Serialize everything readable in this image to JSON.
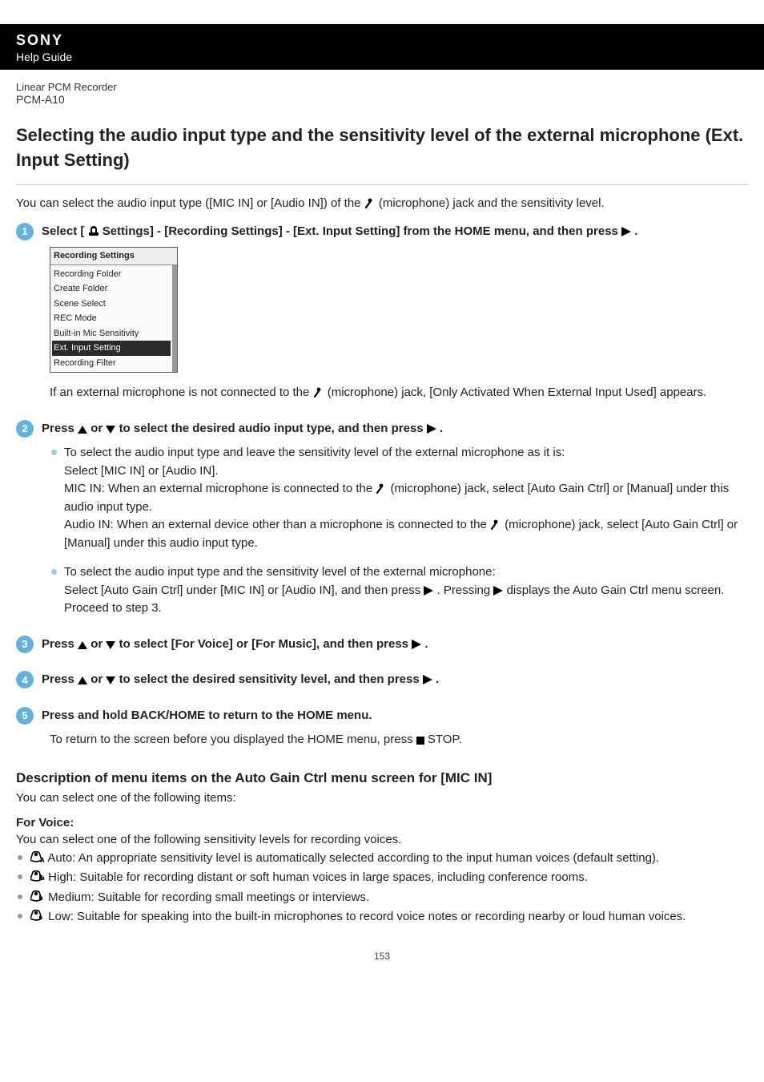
{
  "header": {
    "brand": "SONY",
    "help_guide": "Help Guide",
    "product": "Linear PCM Recorder",
    "model": "PCM-A10"
  },
  "title": "Selecting the audio input type and the sensitivity level of the external microphone (Ext. Input Setting)",
  "intro_parts": {
    "p1": "You can select the audio input type ([MIC IN] or [Audio IN]) of the ",
    "p2": " (microphone) jack and the sensitivity level."
  },
  "step1": {
    "num": "1",
    "inst_parts": {
      "a": "Select [ ",
      "b": " Settings] - [Recording Settings] - [Ext. Input Setting] from the HOME menu, and then press ",
      "c": " ."
    },
    "screenshot": {
      "title": "Recording Settings",
      "items": [
        "Recording Folder",
        "Create Folder",
        "Scene Select",
        "REC Mode",
        "Built-in Mic Sensitivity",
        "Ext. Input Setting",
        "Recording Filter"
      ],
      "selected_index": 5
    },
    "note_parts": {
      "a": "If an external microphone is not connected to the ",
      "b": " (microphone) jack, [Only Activated When External Input Used] appears."
    }
  },
  "step2": {
    "num": "2",
    "inst_parts": {
      "a": "Press ",
      "b": " or ",
      "c": " to select the desired audio input type, and then press ",
      "d": " ."
    },
    "bullet1": {
      "l1": "To select the audio input type and leave the sensitivity level of the external microphone as it is:",
      "l2": "Select [MIC IN] or [Audio IN].",
      "l3a": "MIC IN: When an external microphone is connected to the ",
      "l3b": " (microphone) jack, select [Auto Gain Ctrl] or [Manual] under this audio input type.",
      "l4a": "Audio IN: When an external device other than a microphone is connected to the ",
      "l4b": " (microphone) jack, select [Auto Gain Ctrl] or [Manual] under this audio input type."
    },
    "bullet2": {
      "l1": "To select the audio input type and the sensitivity level of the external microphone:",
      "l2a": "Select [Auto Gain Ctrl] under [MIC IN] or [Audio IN], and then press ",
      "l2b": " . Pressing ",
      "l2c": " displays the Auto Gain Ctrl menu screen. Proceed to step 3."
    }
  },
  "step3": {
    "num": "3",
    "inst_parts": {
      "a": "Press ",
      "b": " or ",
      "c": " to select [For Voice] or [For Music], and then press ",
      "d": " ."
    }
  },
  "step4": {
    "num": "4",
    "inst_parts": {
      "a": "Press ",
      "b": " or ",
      "c": " to select the desired sensitivity level, and then press ",
      "d": " ."
    }
  },
  "step5": {
    "num": "5",
    "inst": "Press and hold BACK/HOME to return to the HOME menu.",
    "body_parts": {
      "a": "To return to the screen before you displayed the HOME menu, press ",
      "b": " STOP."
    }
  },
  "desc": {
    "heading": "Description of menu items on the Auto Gain Ctrl menu screen for [MIC IN]",
    "sub": "You can select one of the following items:",
    "for_voice_heading": "For Voice:",
    "for_voice_sub": "You can select one of the following sensitivity levels for recording voices.",
    "items": {
      "auto": " Auto: An appropriate sensitivity level is automatically selected according to the input human voices (default setting).",
      "high": " High: Suitable for recording distant or soft human voices in large spaces, including conference rooms.",
      "medium": " Medium: Suitable for recording small meetings or interviews.",
      "low": " Low: Suitable for speaking into the built-in microphones to record voice notes or recording nearby or loud human voices."
    }
  },
  "page_number": "153"
}
